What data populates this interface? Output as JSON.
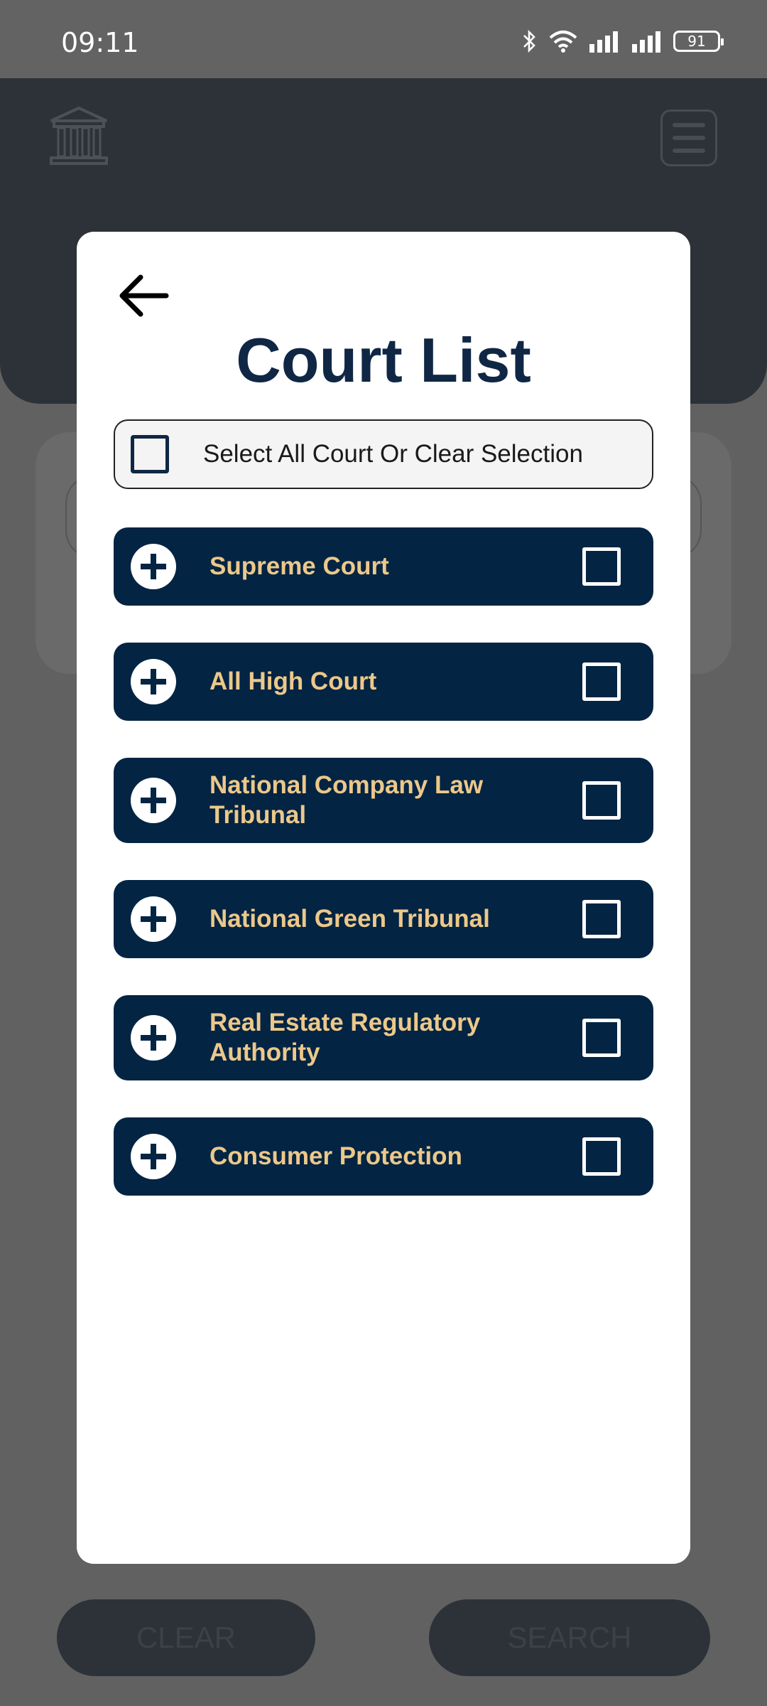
{
  "status_bar": {
    "time": "09:11",
    "battery": "91",
    "icons": [
      "bluetooth-icon",
      "wifi-icon",
      "signal-icon",
      "signal-icon",
      "battery-icon"
    ]
  },
  "background": {
    "buttons": {
      "clear": "CLEAR",
      "search": "SEARCH"
    }
  },
  "modal": {
    "title": "Court List",
    "select_all_label": "Select All Court Or Clear Selection",
    "courts": [
      {
        "line1": "Supreme Court",
        "line2": ""
      },
      {
        "line1": "All High Court",
        "line2": ""
      },
      {
        "line1": "National Company Law",
        "line2": "Tribunal"
      },
      {
        "line1": "National Green Tribunal",
        "line2": ""
      },
      {
        "line1": "Real Estate Regulatory",
        "line2": "Authority"
      },
      {
        "line1": "Consumer Protection",
        "line2": ""
      }
    ]
  },
  "colors": {
    "navy": "#032443",
    "gold_text": "#ecc88a",
    "title": "#0f2745",
    "overlay": "#616161"
  }
}
